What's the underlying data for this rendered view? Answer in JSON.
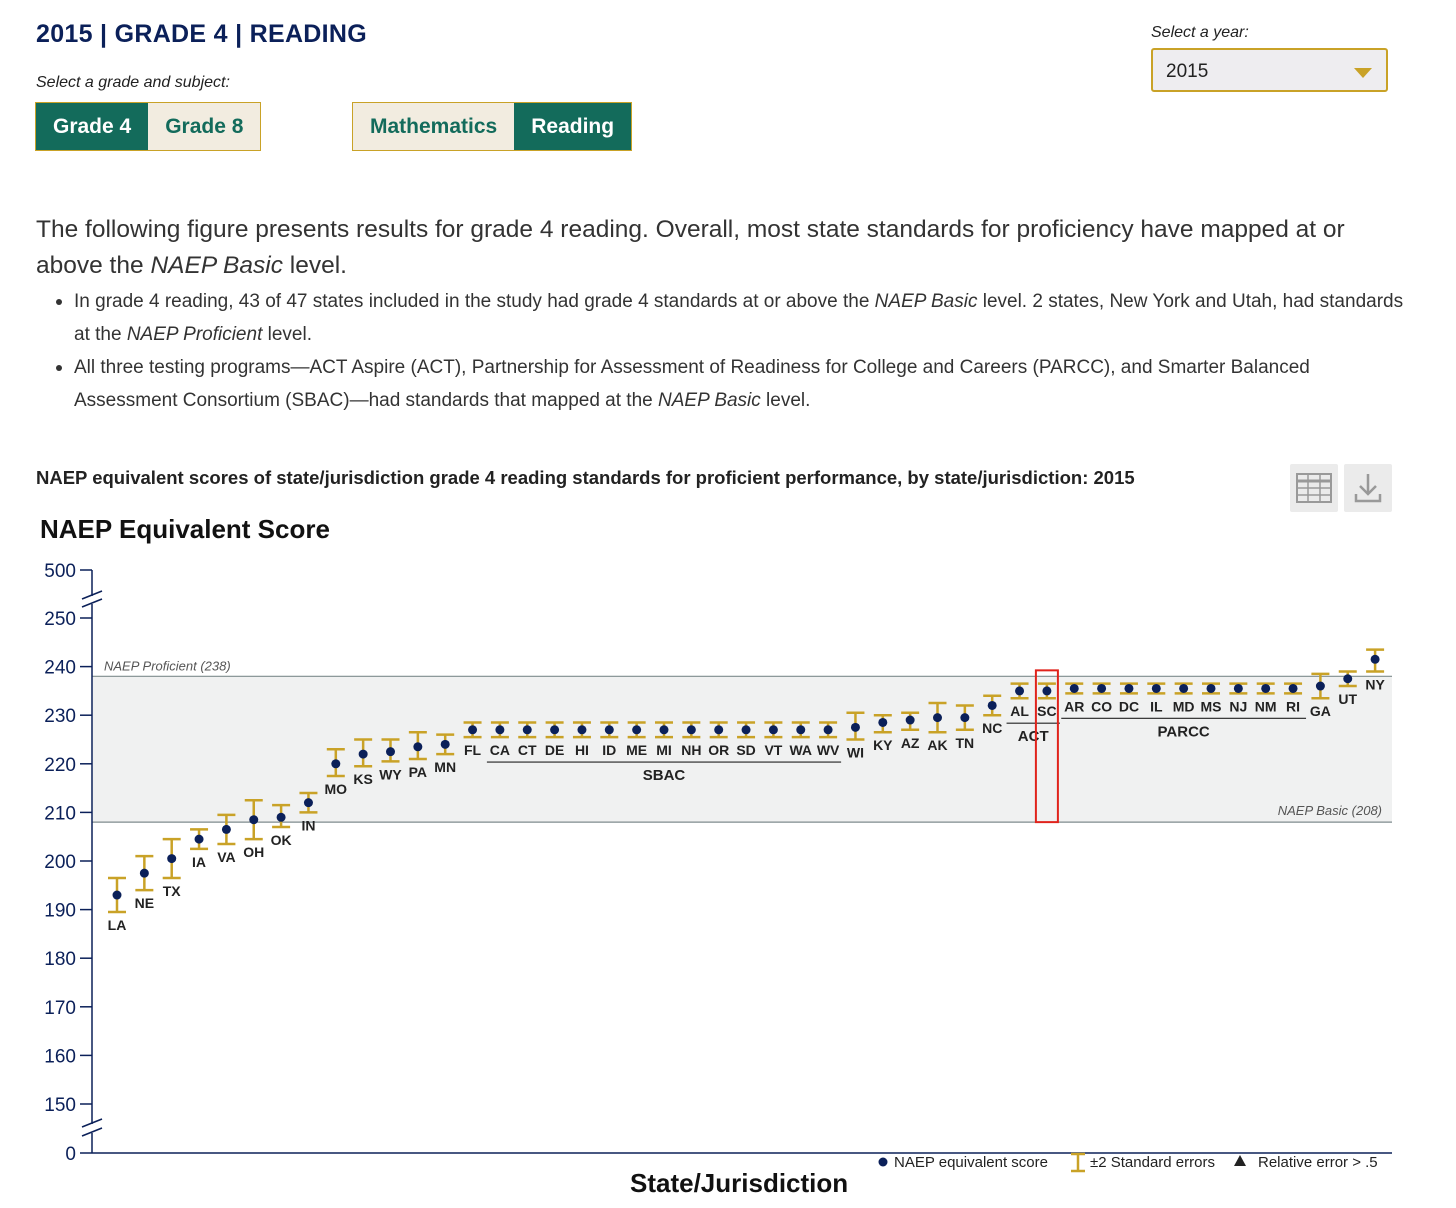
{
  "header": {
    "title": "2015 | GRADE 4 | READING",
    "grade_subject_label": "Select a grade and subject:",
    "grade_buttons": [
      "Grade 4",
      "Grade 8"
    ],
    "subject_buttons": [
      "Mathematics",
      "Reading"
    ],
    "year_label": "Select a year:",
    "year_value": "2015"
  },
  "intro": {
    "lead_1": "The following figure presents results for grade 4 reading. Overall, most state standards for proficiency have mapped at or above the ",
    "lead_em": "NAEP Basic",
    "lead_2": " level.",
    "bullet1_a": "In grade 4 reading, 43 of 47 states included in the study had grade 4 standards at or above the ",
    "bullet1_em": "NAEP Basic",
    "bullet1_b": " level. 2 states, New York and Utah, had standards at the ",
    "bullet1_em2": "NAEP Proficient",
    "bullet1_c": " level.",
    "bullet2_a": "All three testing programs—ACT Aspire (ACT), Partnership for Assessment of Readiness for College and Careers (PARCC), and Smarter Balanced Assessment Consortium (SBAC)—had standards that mapped at the ",
    "bullet2_em": "NAEP Basic",
    "bullet2_b": " level."
  },
  "chart_title": "NAEP equivalent scores of state/jurisdiction grade 4 reading standards for proficient performance, by state/jurisdiction: 2015",
  "icons": {
    "table": "table-icon",
    "download": "download-icon"
  },
  "colors": {
    "navy": "#0b2059",
    "gold": "#c9a227",
    "green": "#136b5b",
    "band": "#f0f1f1",
    "highlight": "#e0231c"
  },
  "chart_data": {
    "type": "scatter",
    "ylabel": "NAEP Equivalent Score",
    "xlabel": "State/Jurisdiction",
    "yticks": [
      0,
      150,
      160,
      170,
      180,
      190,
      200,
      210,
      220,
      230,
      240,
      250,
      500
    ],
    "ylim": [
      150,
      250
    ],
    "axis_breaks": [
      "0-150",
      "250-500"
    ],
    "reference_lines": [
      {
        "label": "NAEP Proficient (238)",
        "value": 238
      },
      {
        "label": "NAEP Basic (208)",
        "value": 208
      }
    ],
    "points": [
      {
        "state": "LA",
        "score": 193.0,
        "lo": 189.5,
        "hi": 196.5
      },
      {
        "state": "NE",
        "score": 197.5,
        "lo": 194.0,
        "hi": 201.0
      },
      {
        "state": "TX",
        "score": 200.5,
        "lo": 196.5,
        "hi": 204.5
      },
      {
        "state": "IA",
        "score": 204.5,
        "lo": 202.5,
        "hi": 206.5
      },
      {
        "state": "VA",
        "score": 206.5,
        "lo": 203.5,
        "hi": 209.5
      },
      {
        "state": "OH",
        "score": 208.5,
        "lo": 204.5,
        "hi": 212.5
      },
      {
        "state": "OK",
        "score": 209.0,
        "lo": 207.0,
        "hi": 211.5
      },
      {
        "state": "IN",
        "score": 212.0,
        "lo": 210.0,
        "hi": 214.0
      },
      {
        "state": "MO",
        "score": 220.0,
        "lo": 217.5,
        "hi": 223.0
      },
      {
        "state": "KS",
        "score": 222.0,
        "lo": 219.5,
        "hi": 225.0
      },
      {
        "state": "WY",
        "score": 222.5,
        "lo": 220.5,
        "hi": 225.0
      },
      {
        "state": "PA",
        "score": 223.5,
        "lo": 221.0,
        "hi": 226.5
      },
      {
        "state": "MN",
        "score": 224.0,
        "lo": 222.0,
        "hi": 226.0
      },
      {
        "state": "FL",
        "score": 227.0,
        "lo": 225.5,
        "hi": 228.5
      },
      {
        "state": "CA",
        "score": 227.0,
        "lo": 225.5,
        "hi": 228.5
      },
      {
        "state": "CT",
        "score": 227.0,
        "lo": 225.5,
        "hi": 228.5
      },
      {
        "state": "DE",
        "score": 227.0,
        "lo": 225.5,
        "hi": 228.5
      },
      {
        "state": "HI",
        "score": 227.0,
        "lo": 225.5,
        "hi": 228.5
      },
      {
        "state": "ID",
        "score": 227.0,
        "lo": 225.5,
        "hi": 228.5
      },
      {
        "state": "ME",
        "score": 227.0,
        "lo": 225.5,
        "hi": 228.5
      },
      {
        "state": "MI",
        "score": 227.0,
        "lo": 225.5,
        "hi": 228.5
      },
      {
        "state": "NH",
        "score": 227.0,
        "lo": 225.5,
        "hi": 228.5
      },
      {
        "state": "OR",
        "score": 227.0,
        "lo": 225.5,
        "hi": 228.5
      },
      {
        "state": "SD",
        "score": 227.0,
        "lo": 225.5,
        "hi": 228.5
      },
      {
        "state": "VT",
        "score": 227.0,
        "lo": 225.5,
        "hi": 228.5
      },
      {
        "state": "WA",
        "score": 227.0,
        "lo": 225.5,
        "hi": 228.5
      },
      {
        "state": "WV",
        "score": 227.0,
        "lo": 225.5,
        "hi": 228.5
      },
      {
        "state": "WI",
        "score": 227.5,
        "lo": 225.0,
        "hi": 230.5
      },
      {
        "state": "KY",
        "score": 228.5,
        "lo": 226.5,
        "hi": 230.0
      },
      {
        "state": "AZ",
        "score": 229.0,
        "lo": 227.0,
        "hi": 230.5
      },
      {
        "state": "AK",
        "score": 229.5,
        "lo": 226.5,
        "hi": 232.5
      },
      {
        "state": "TN",
        "score": 229.5,
        "lo": 227.0,
        "hi": 232.0
      },
      {
        "state": "NC",
        "score": 232.0,
        "lo": 230.0,
        "hi": 234.0
      },
      {
        "state": "AL",
        "score": 235.0,
        "lo": 233.5,
        "hi": 236.5
      },
      {
        "state": "SC",
        "score": 235.0,
        "lo": 233.5,
        "hi": 236.5
      },
      {
        "state": "AR",
        "score": 235.5,
        "lo": 234.5,
        "hi": 236.5
      },
      {
        "state": "CO",
        "score": 235.5,
        "lo": 234.5,
        "hi": 236.5
      },
      {
        "state": "DC",
        "score": 235.5,
        "lo": 234.5,
        "hi": 236.5
      },
      {
        "state": "IL",
        "score": 235.5,
        "lo": 234.5,
        "hi": 236.5
      },
      {
        "state": "MD",
        "score": 235.5,
        "lo": 234.5,
        "hi": 236.5
      },
      {
        "state": "MS",
        "score": 235.5,
        "lo": 234.5,
        "hi": 236.5
      },
      {
        "state": "NJ",
        "score": 235.5,
        "lo": 234.5,
        "hi": 236.5
      },
      {
        "state": "NM",
        "score": 235.5,
        "lo": 234.5,
        "hi": 236.5
      },
      {
        "state": "RI",
        "score": 235.5,
        "lo": 234.5,
        "hi": 236.5
      },
      {
        "state": "GA",
        "score": 236.0,
        "lo": 233.5,
        "hi": 238.5
      },
      {
        "state": "UT",
        "score": 237.5,
        "lo": 236.0,
        "hi": 239.0
      },
      {
        "state": "NY",
        "score": 241.5,
        "lo": 239.0,
        "hi": 243.5
      }
    ],
    "groups": [
      {
        "label": "SBAC",
        "first": "CA",
        "last": "WV"
      },
      {
        "label": "ACT",
        "first": "AL",
        "last": "SC"
      },
      {
        "label": "PARCC",
        "first": "AR",
        "last": "RI"
      }
    ],
    "highlighted_state": "SC",
    "legend": [
      "NAEP equivalent score",
      "±2 Standard errors",
      "Relative error > .5"
    ],
    "legend_placement": "bottom-right"
  }
}
